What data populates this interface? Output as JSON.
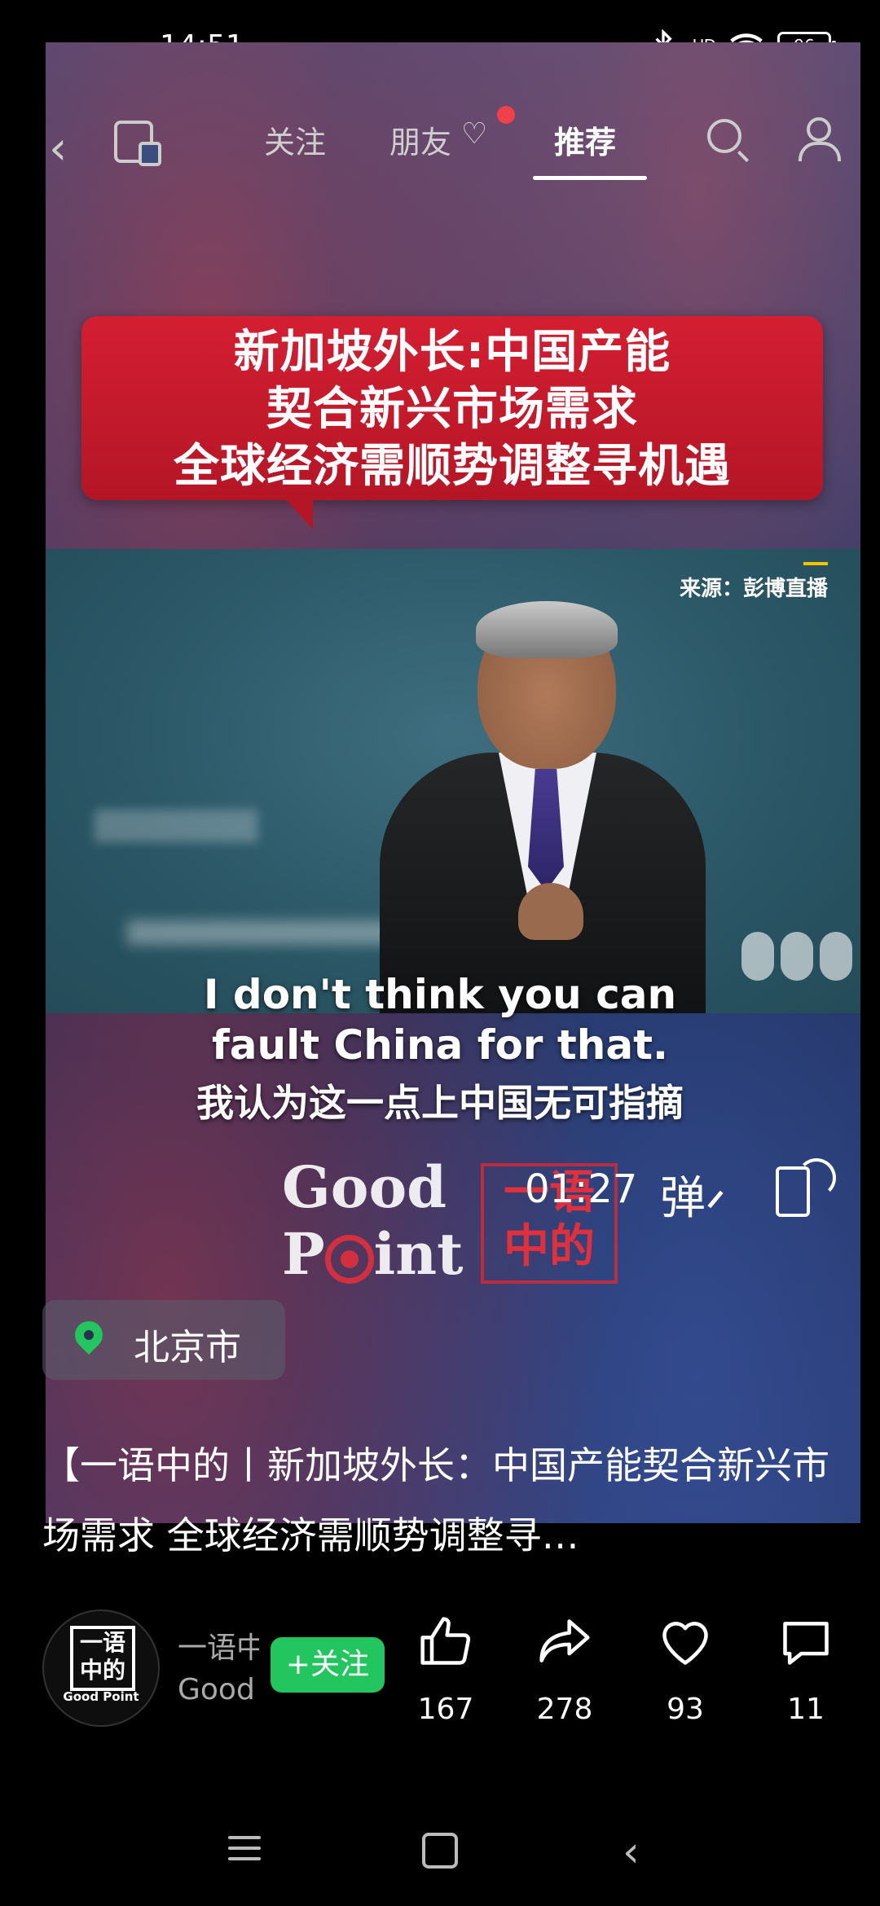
{
  "status": {
    "time": "14:51",
    "signal": "HD",
    "battery": "96"
  },
  "nav": {
    "tabs": [
      "关注",
      "朋友",
      "推荐"
    ],
    "active_tab": "推荐"
  },
  "video": {
    "headline": [
      "新加坡外长:中国产能",
      "契合新兴市场需求",
      "全球经济需顺势调整寻机遇"
    ],
    "source": "来源：彭博直播",
    "subtitle_en": [
      "I don't think you can",
      "fault China for that."
    ],
    "subtitle_zh": "我认为这一点上中国无可指摘",
    "watermark": {
      "good": "Good",
      "point": "Point",
      "cn": [
        "一语",
        "中的"
      ]
    },
    "time": "01:27",
    "danmu": "弹"
  },
  "location": "北京市",
  "caption": "【一语中的丨新加坡外长：中国产能契合新兴市场需求 全球经济需顺势调整寻…",
  "author": {
    "name": "一语中的",
    "sub": "Good Point",
    "avatar_text": [
      "一语",
      "中的"
    ],
    "avatar_label": "Good Point",
    "follow_label": "+关注"
  },
  "actions": {
    "like": "167",
    "share": "278",
    "favorite": "93",
    "comment": "11"
  },
  "icons": [
    "back-icon",
    "switch-icon",
    "search-icon",
    "user-icon",
    "location-pin-icon",
    "thumbs-up-icon",
    "share-icon",
    "heart-icon",
    "comment-icon",
    "rotate-icon"
  ],
  "colors": {
    "headline_red": "#c81a2c",
    "follow_green": "#22c55e",
    "notify_red": "#f0404a"
  }
}
